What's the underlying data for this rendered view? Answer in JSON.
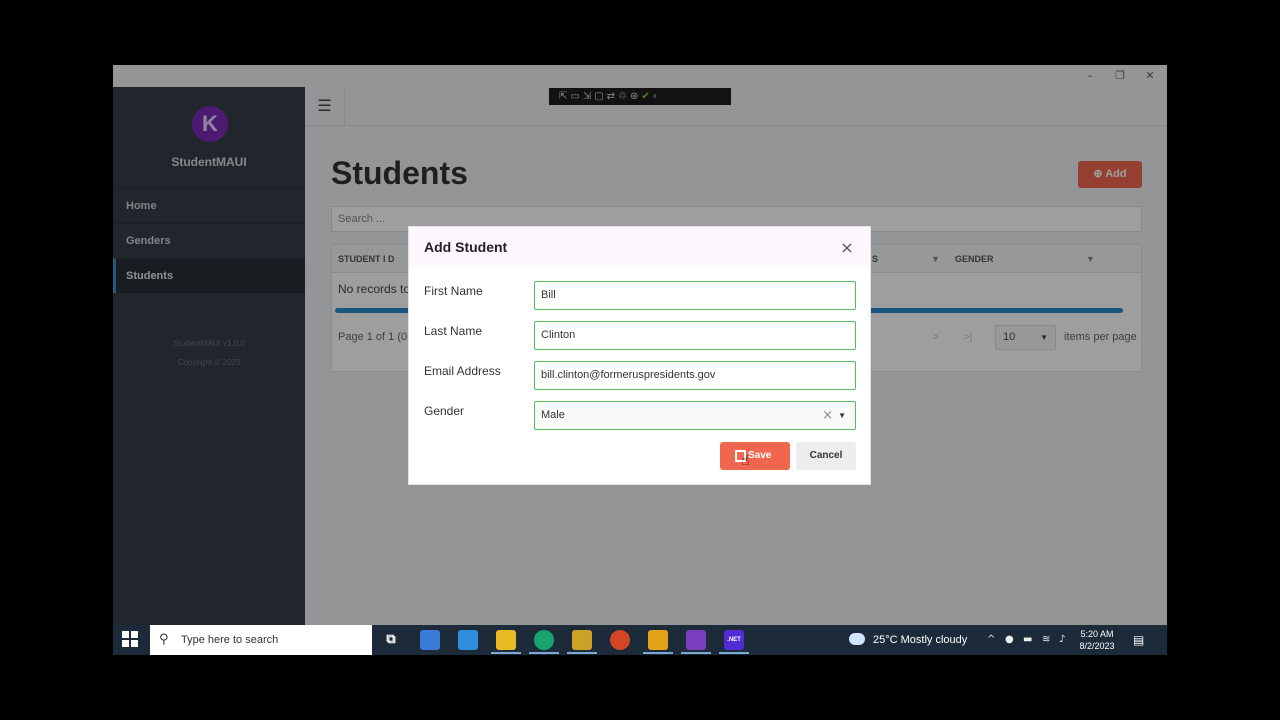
{
  "window": {
    "minimize": "–",
    "maximize": "❐",
    "close": "✕"
  },
  "sidebar": {
    "logo_letter": "K",
    "app_name": "StudentMAUI",
    "items": [
      {
        "label": "Home"
      },
      {
        "label": "Genders"
      },
      {
        "label": "Students"
      }
    ],
    "version": "StudentMAUI v1.0.0",
    "copyright": "Copyright © 2023"
  },
  "topbar": {
    "menu_icon": "☰"
  },
  "devtools": {
    "icons": "⇱▭⇲▢⇄♲⊛",
    "ok": "✔",
    "collapse": "‹"
  },
  "page": {
    "title": "Students",
    "add_label": "⊕ Add",
    "search_placeholder": "Search ..."
  },
  "grid": {
    "columns": [
      {
        "label": "STUDENT I D"
      },
      {
        "label": "S"
      },
      {
        "label": "GENDER"
      }
    ],
    "filter_icon": "▼",
    "no_records": "No records to",
    "pager_text": "Page 1 of 1 (0",
    "next": ">",
    "last": ">|",
    "page_size": "10",
    "items_per_page": "items per page"
  },
  "dialog": {
    "title": "Add Student",
    "close": "×",
    "fields": [
      {
        "label": "First Name",
        "value": "Bill"
      },
      {
        "label": "Last Name",
        "value": "Clinton"
      },
      {
        "label": "Email Address",
        "value": "bill.clinton@formeruspresidents.gov"
      },
      {
        "label": "Gender",
        "value": "Male"
      }
    ],
    "clear_icon": "×",
    "save_label": "Save",
    "cancel_label": "Cancel"
  },
  "taskbar": {
    "search_placeholder": "Type here to search",
    "weather": "25°C  Mostly cloudy",
    "time": "5:20 AM",
    "date": "8/2/2023",
    "net_label": ".NET"
  },
  "colors": {
    "accent": "#f0664f",
    "sidebar": "#343e47",
    "valid_border": "#5cb85c",
    "progress": "#2b8ad1"
  }
}
